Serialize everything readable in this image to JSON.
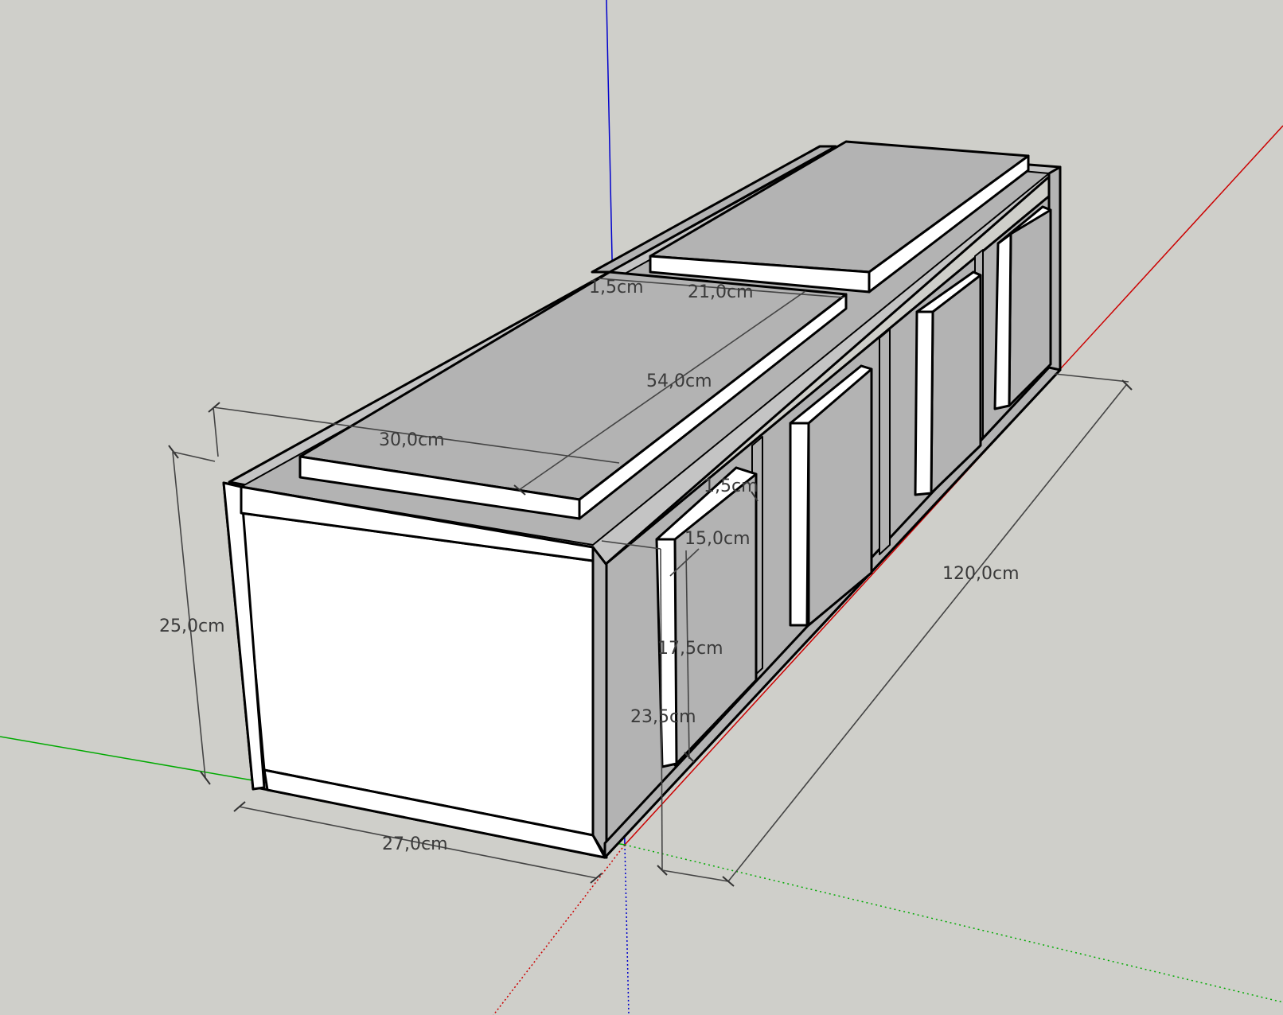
{
  "colors": {
    "background": "#cfcfca",
    "x_axis": "#cc0000",
    "y_axis": "#00aa00",
    "z_axis": "#0000cc",
    "face_white": "#ffffff",
    "face_gray": "#b3b3b3",
    "edge": "#000000"
  },
  "dimensions": {
    "height_total": "25,0cm",
    "depth_bottom": "27,0cm",
    "lid_depth": "30,0cm",
    "lid_length": "54,0cm",
    "lid2_length": "21,0cm",
    "lid_thickness": "1,5cm",
    "divider_thickness": "1,5cm",
    "divider_width": "15,0cm",
    "divider_height": "17,5cm",
    "inner_height": "23,5cm",
    "length_total": "120,0cm"
  }
}
